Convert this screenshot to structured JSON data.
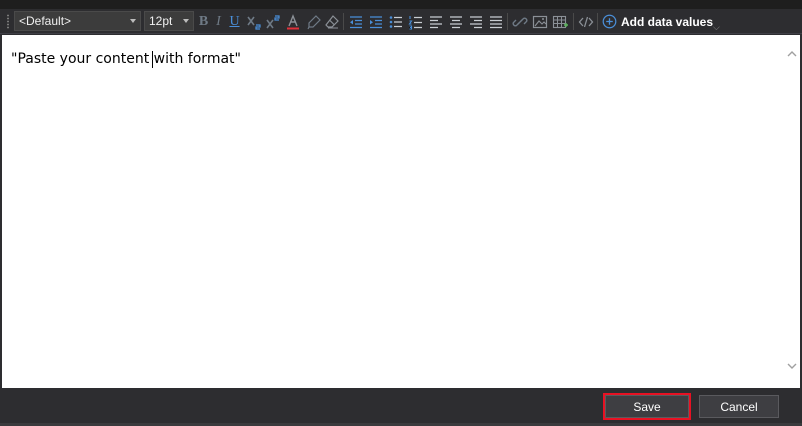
{
  "toolbar": {
    "font_family": "<Default>",
    "font_size": "12pt",
    "bold_glyph": "B",
    "italic_glyph": "I",
    "underline_glyph": "U",
    "add_data_values_label": "Add data values",
    "icons": [
      "bold-icon",
      "italic-icon",
      "underline-icon",
      "subscript-icon",
      "superscript-icon",
      "font-color-icon",
      "highlight-icon",
      "clear-format-icon",
      "outdent-icon",
      "indent-icon",
      "bullet-list-icon",
      "numbered-list-icon",
      "align-left-icon",
      "align-center-icon",
      "align-right-icon",
      "justify-icon",
      "link-icon",
      "image-icon",
      "table-icon",
      "source-code-icon",
      "add-circle-icon"
    ]
  },
  "editor": {
    "content": "\"Paste your content with format\""
  },
  "footer": {
    "save_label": "Save",
    "cancel_label": "Cancel"
  },
  "colors": {
    "accent_red": "#e81123",
    "icon_blue": "#4a8fd9",
    "font_color_red": "#e0303a"
  }
}
